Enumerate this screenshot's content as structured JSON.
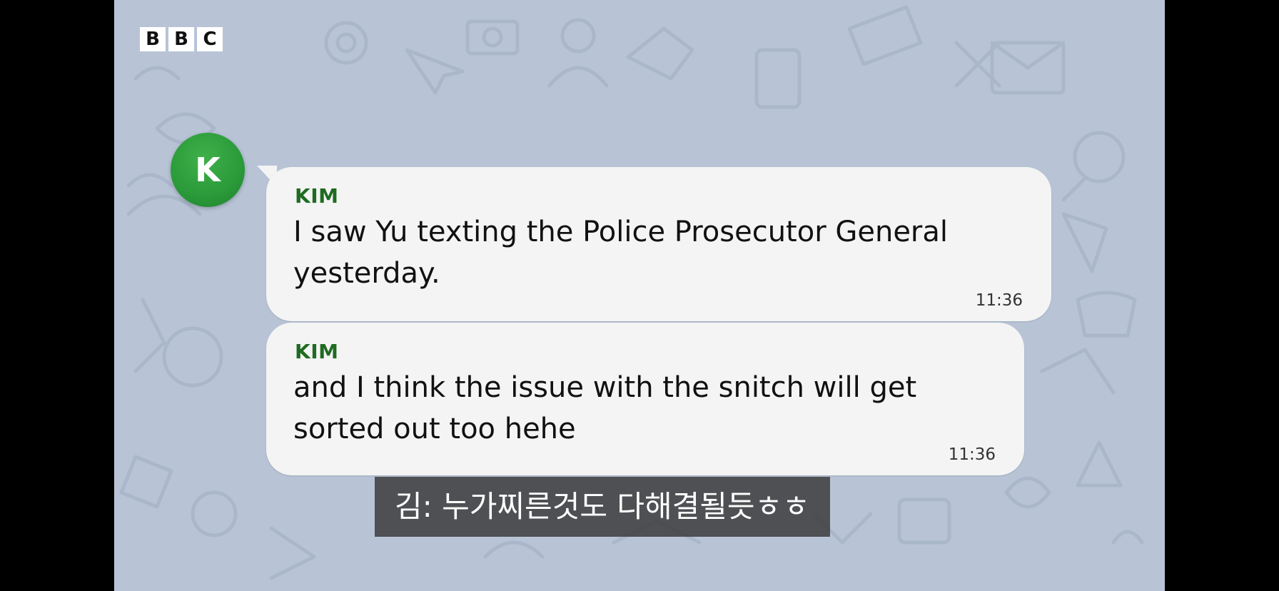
{
  "branding": {
    "logo_letters": [
      "B",
      "B",
      "C"
    ]
  },
  "colors": {
    "wallpaper": "#b8c4d6",
    "bubble": "#f4f4f4",
    "sender_name": "#1f6b21",
    "avatar": "#2a9a3a",
    "subtitle_bg": "#3c3c3c"
  },
  "chat": {
    "avatar_initial": "K",
    "messages": [
      {
        "sender": "KIM",
        "text": "I saw Yu texting the Police Prosecutor General yesterday.",
        "time": "11:36"
      },
      {
        "sender": "KIM",
        "text": "and I think the issue with the snitch will get sorted out too hehe",
        "time": "11:36"
      }
    ]
  },
  "subtitle": {
    "text": "김: 누가찌른것도 다해결될듯ㅎㅎ"
  }
}
